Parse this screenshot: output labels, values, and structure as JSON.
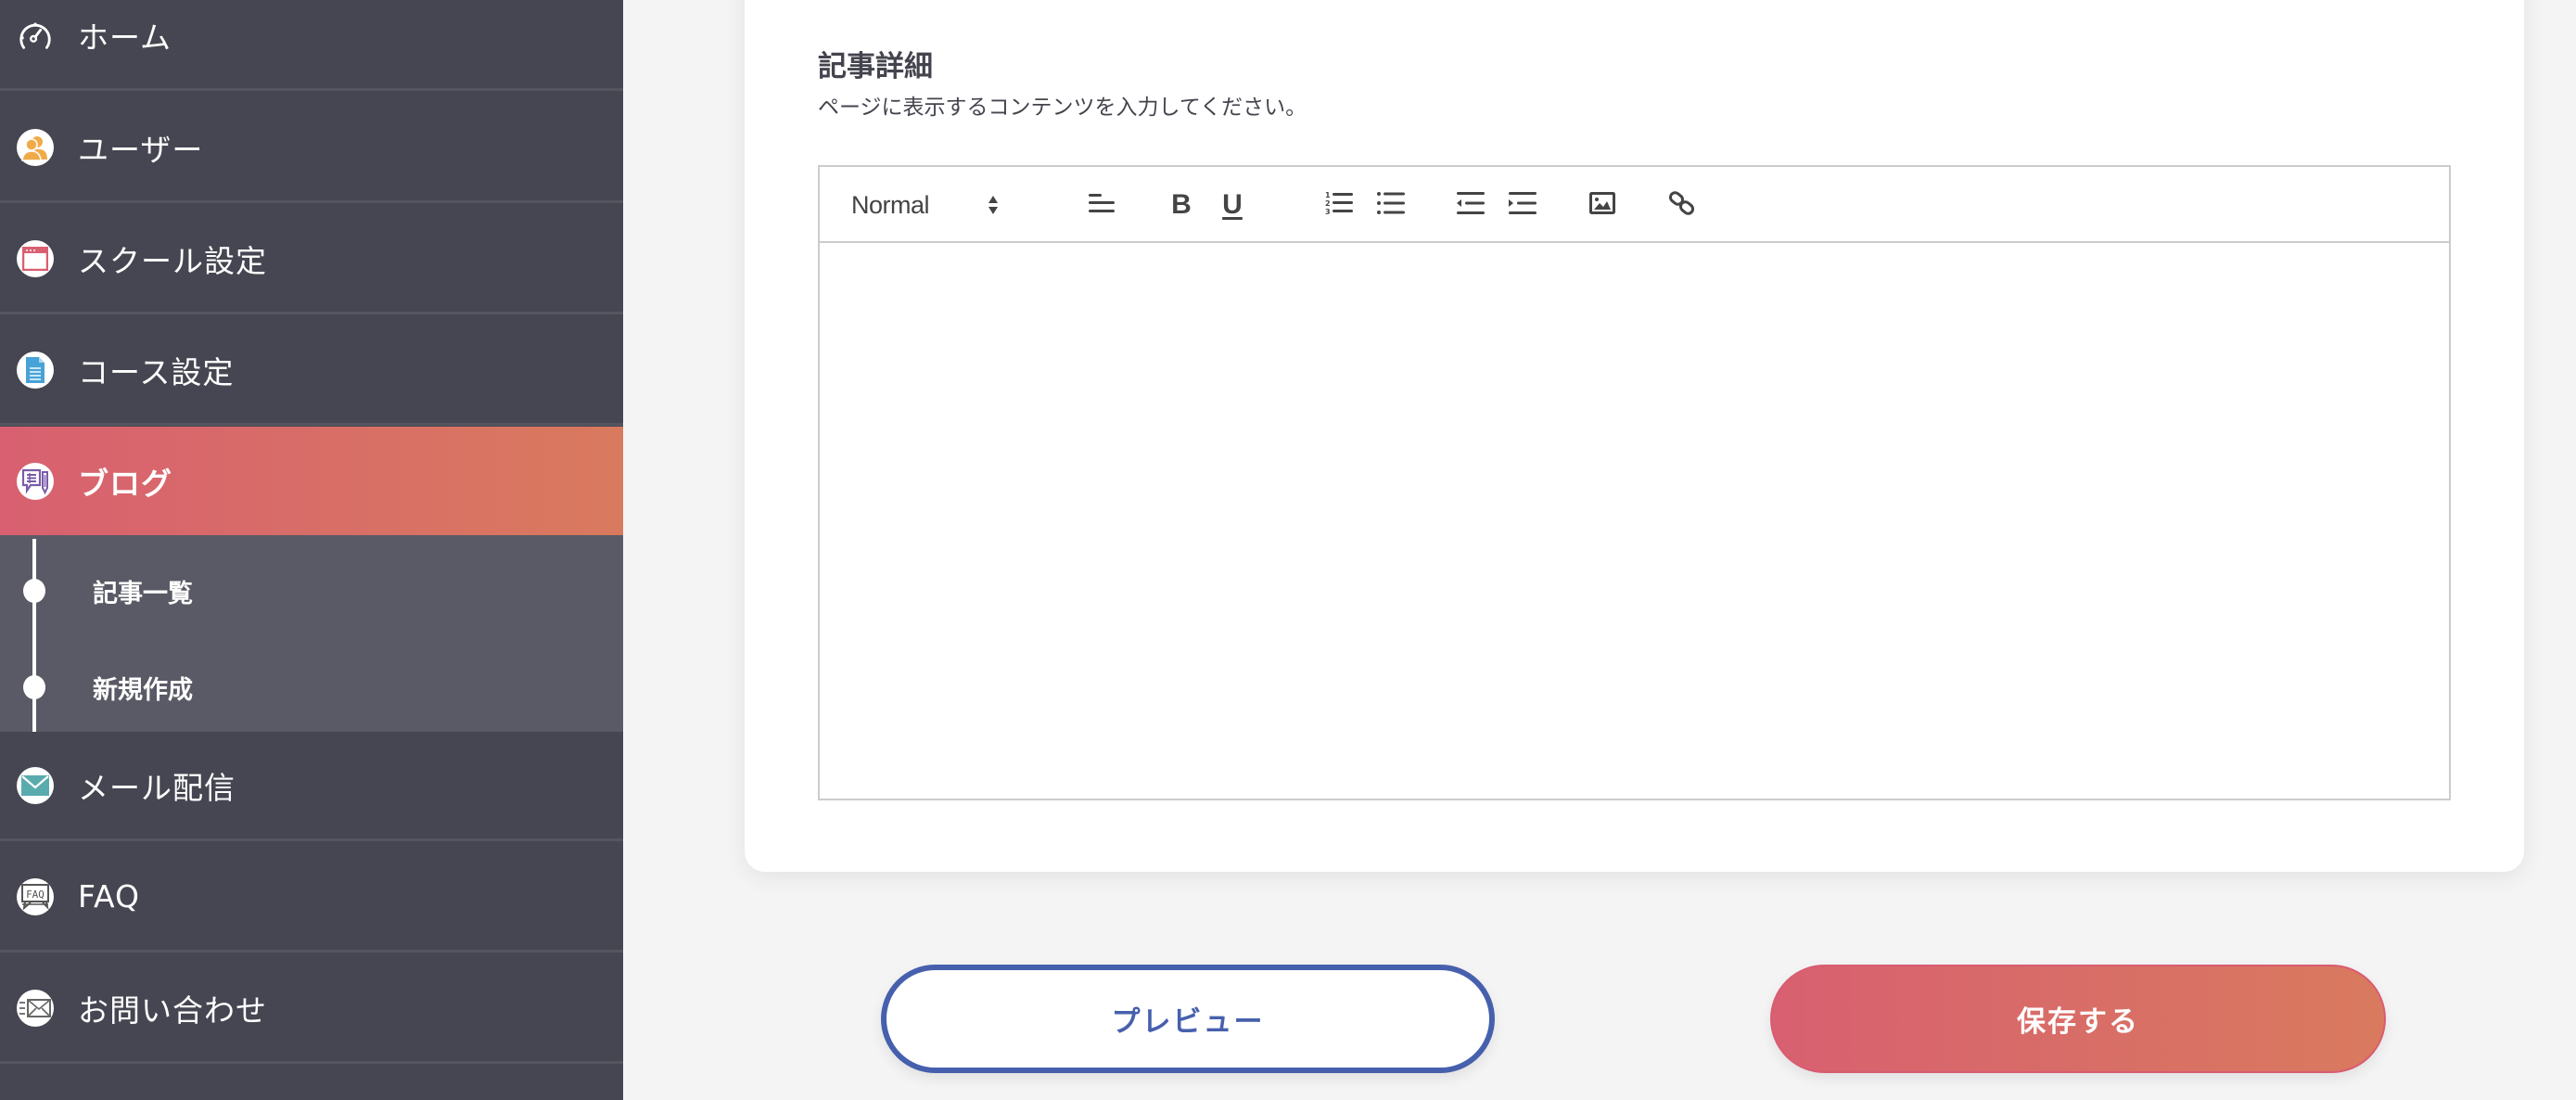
{
  "sidebar": {
    "items": [
      {
        "label": "ホーム",
        "icon": "speedometer-icon"
      },
      {
        "label": "ユーザー",
        "icon": "users-icon"
      },
      {
        "label": "スクール設定",
        "icon": "browser-window-icon"
      },
      {
        "label": "コース設定",
        "icon": "document-icon"
      },
      {
        "label": "ブログ",
        "icon": "blog-edit-icon",
        "active": true
      },
      {
        "label": "メール配信",
        "icon": "mail-icon"
      },
      {
        "label": "FAQ",
        "icon": "faq-icon"
      },
      {
        "label": "お問い合わせ",
        "icon": "send-mail-icon"
      }
    ],
    "blog_submenu": [
      {
        "label": "記事一覧"
      },
      {
        "label": "新規作成"
      }
    ]
  },
  "main": {
    "section_title": "記事詳細",
    "section_description": "ページに表示するコンテンツを入力してください。",
    "editor": {
      "format_select": "Normal",
      "toolbar_buttons": [
        "align-left",
        "bold",
        "underline",
        "ordered-list",
        "bullet-list",
        "outdent",
        "indent",
        "image",
        "link"
      ],
      "bold_glyph": "B",
      "underline_glyph": "U",
      "content": ""
    }
  },
  "actions": {
    "preview_label": "プレビュー",
    "save_label": "保存する"
  },
  "colors": {
    "sidebar_bg": "#464652",
    "submenu_bg": "#5a5a66",
    "accent_gradient_start": "#d86070",
    "accent_gradient_end": "#d97a5e",
    "preview_blue": "#4660ad",
    "text_dark": "#44444e"
  }
}
